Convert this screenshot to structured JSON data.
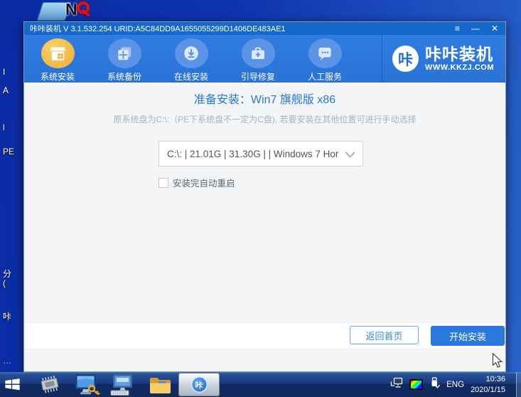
{
  "desktop": {
    "fragments": [
      "I",
      "A",
      "l",
      "PE",
      "分",
      "(",
      "咔",
      "…"
    ],
    "n_icon_letter": "N"
  },
  "window": {
    "titlebar": {
      "title": "咔咔装机 V 3.1.532.254 URID:A5C84DD9A1655055299D1406DE483AE1",
      "menu_icon": "≡",
      "minimize_icon": "—",
      "close_icon": "✕"
    },
    "nav": [
      {
        "label": "系统安装",
        "active": true,
        "icon": "install-box-icon"
      },
      {
        "label": "系统备份",
        "active": false,
        "icon": "backup-copies-icon"
      },
      {
        "label": "在线安装",
        "active": false,
        "icon": "download-circle-icon"
      },
      {
        "label": "引导修复",
        "active": false,
        "icon": "repair-toolbox-icon"
      },
      {
        "label": "人工服务",
        "active": false,
        "icon": "chat-service-icon"
      }
    ],
    "logo": {
      "badge": "咔",
      "title": "咔咔装机",
      "url": "WWW.KKZJ.COM"
    },
    "content": {
      "heading": "准备安装：Win7 旗舰版 x86",
      "note": "原系统盘为C:\\:（PE下系统盘不一定为C盘), 若要安装在其他位置可进行手动选择",
      "drive_value": "C:\\: | 21.01G | 31.30G | | Windows 7 Hor",
      "auto_restart_label": "安装完自动重启",
      "auto_restart_checked": false
    },
    "footer": {
      "back": "返回首页",
      "start": "开始安装"
    }
  },
  "taskbar": {
    "icons": [
      "start",
      "cpu-chip",
      "pe-lock-tool",
      "pe-remote-tool",
      "file-explorer",
      "kaka-installer"
    ],
    "kaka_badge": "咔",
    "tray": {
      "icons": [
        "network",
        "display",
        "usb-device"
      ],
      "language": "ENG",
      "time": "10:36",
      "date": "2020/1/15"
    }
  },
  "colors": {
    "titlebar_blue": "#1568cc",
    "nav_blue": "#2b76dc",
    "active_gold": "#f0b83e",
    "accent_blue": "#2478d8",
    "taskbar_navy": "#12295c"
  }
}
